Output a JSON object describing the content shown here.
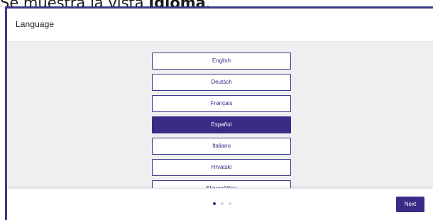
{
  "caption": {
    "prefix": "Se muestra la vista ",
    "bold": "Idioma",
    "suffix": "."
  },
  "header": {
    "title": "Language"
  },
  "languages": {
    "items": [
      {
        "label": "English"
      },
      {
        "label": "Deutsch"
      },
      {
        "label": "Français"
      },
      {
        "label": "Español",
        "selected": true
      },
      {
        "label": "Italiano"
      },
      {
        "label": "Hrvatski"
      },
      {
        "label": "Slovenščina"
      }
    ],
    "selected": "Español"
  },
  "pagination": {
    "total": 3,
    "current": 1
  },
  "footer": {
    "next_label": "Next"
  },
  "colors": {
    "accent": "#3a2b86",
    "border": "#3a3a8c",
    "background": "#efeff1"
  }
}
